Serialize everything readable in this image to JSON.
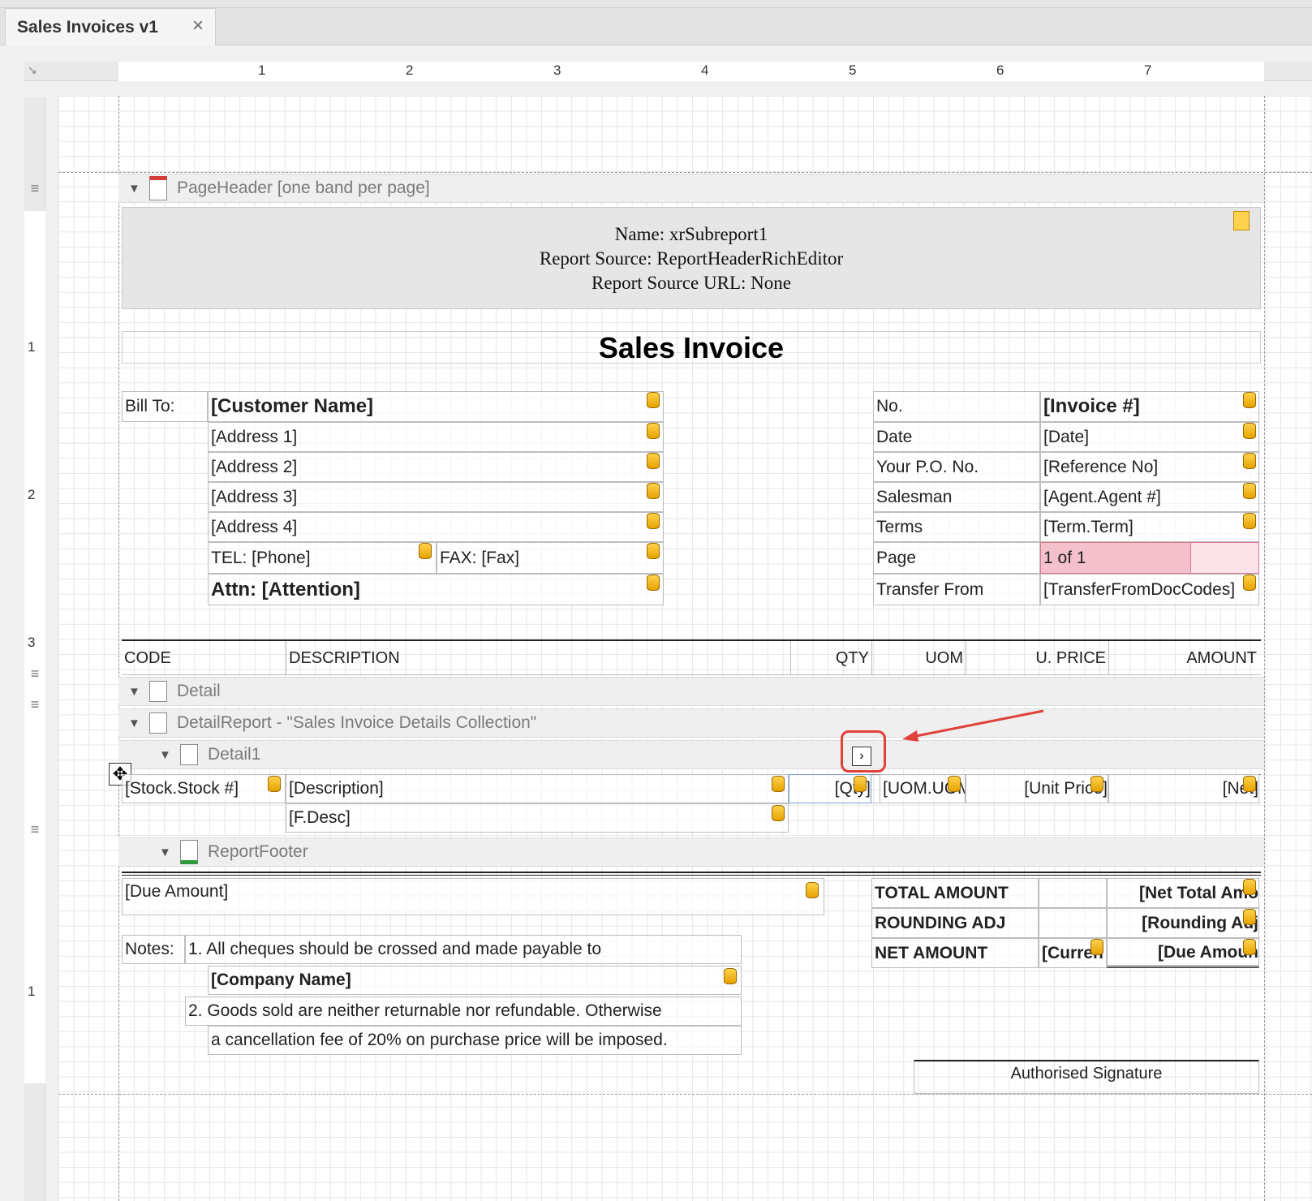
{
  "tab": {
    "title": "Sales Invoices v1"
  },
  "ruler": {
    "top": [
      "1",
      "2",
      "3",
      "4",
      "5",
      "6",
      "7"
    ],
    "left": [
      "1",
      "2",
      "3",
      "1"
    ]
  },
  "bands": {
    "page_header": "PageHeader [one band per page]",
    "detail": "Detail",
    "detail_report": "DetailReport - \"Sales Invoice Details Collection\"",
    "detail1": "Detail1",
    "report_footer": "ReportFooter"
  },
  "subreport": {
    "name": "Name: xrSubreport1",
    "source": "Report Source: ReportHeaderRichEditor",
    "source_url": "Report Source URL: None"
  },
  "title": "Sales Invoice",
  "bill_to": {
    "label": "Bill To:",
    "customer": "[Customer Name]",
    "address1": "[Address 1]",
    "address2": "[Address 2]",
    "address3": "[Address 3]",
    "address4": "[Address 4]",
    "tel": "TEL: [Phone]",
    "fax": "FAX: [Fax]",
    "attn": "Attn: [Attention]"
  },
  "invoice_info": {
    "rows": [
      {
        "label": "No.",
        "value": "[Invoice #]"
      },
      {
        "label": "Date",
        "value": "[Date]"
      },
      {
        "label": "Your P.O. No.",
        "value": "[Reference No]"
      },
      {
        "label": "Salesman",
        "value": "[Agent.Agent #]"
      },
      {
        "label": "Terms",
        "value": "[Term.Term]"
      },
      {
        "label": "Page",
        "value": "1 of 1"
      },
      {
        "label": "Transfer From",
        "value": "[TransferFromDocCodes]"
      }
    ]
  },
  "columns": {
    "code": "CODE",
    "description": "DESCRIPTION",
    "qty": "QTY",
    "uom": "UOM",
    "uprice": "U. PRICE",
    "amount": "AMOUNT"
  },
  "detail_row": {
    "stock": "[Stock.Stock #]",
    "description": "[Description]",
    "qty": "[Qty]",
    "uom": "[UOM.UOM",
    "unit_price": "[Unit Price]",
    "net": "[Net]",
    "fdesc": "[F.Desc]"
  },
  "footer": {
    "due_amount": "[Due Amount]",
    "notes_label": "Notes:",
    "note1": "1. All cheques should be crossed and made payable to",
    "company": "[Company Name]",
    "note2": "2. Goods sold are neither returnable nor refundable. Otherwise",
    "note2b": "a cancellation fee of 20% on purchase price will be imposed.",
    "total_label": "TOTAL AMOUNT",
    "total_value": "[Net Total Amo",
    "rounding_label": "ROUNDING ADJ",
    "rounding_value": "[Rounding Adj",
    "net_label": "NET AMOUNT",
    "currency": "[Curren",
    "net_value": "[Due Amoun",
    "signature": "Authorised Signature"
  },
  "colors": {
    "annotation": "#e0413a",
    "highlight": "#f3c0cc"
  }
}
